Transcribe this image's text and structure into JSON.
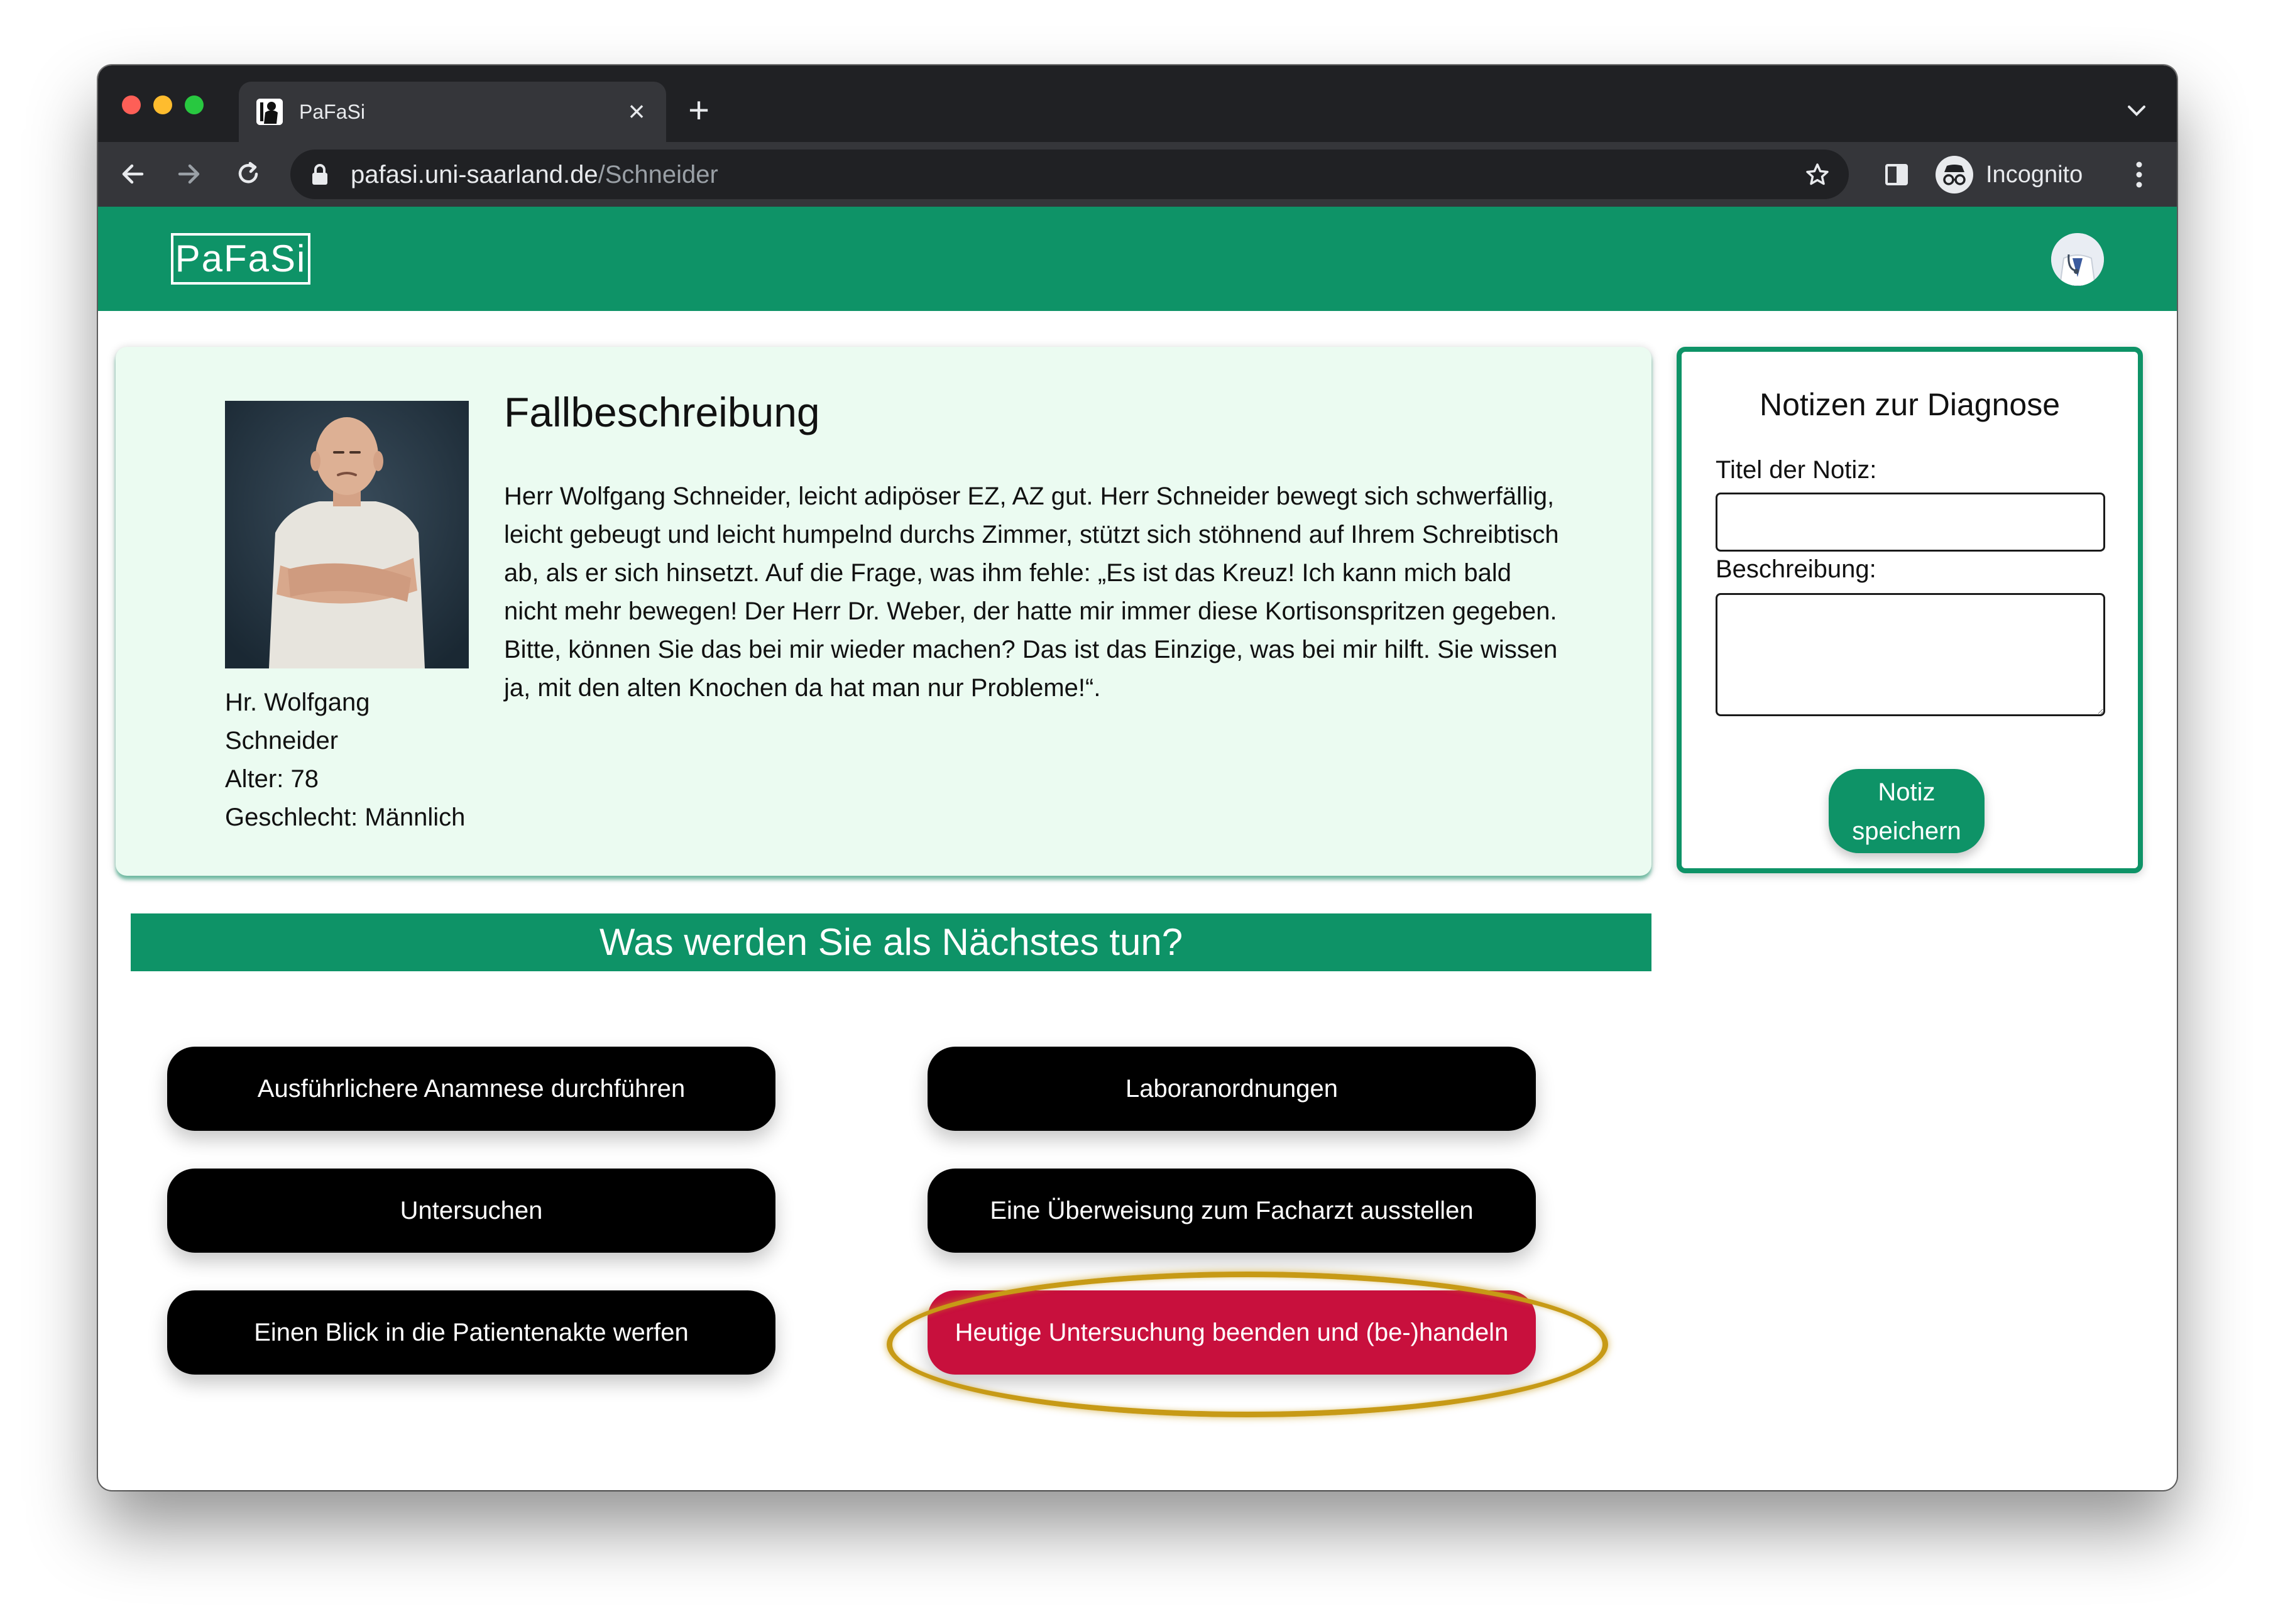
{
  "browser": {
    "tab_title": "PaFaSi",
    "url_host": "pafasi.uni-saarland.de",
    "url_path": "/Schneider",
    "profile_label": "Incognito",
    "icons": [
      "back-arrow-icon",
      "forward-arrow-icon",
      "reload-icon",
      "lock-icon",
      "star-icon",
      "side-panel-icon",
      "incognito-icon",
      "more-vert-icon",
      "close-icon",
      "plus-icon",
      "chevron-down-icon"
    ]
  },
  "app": {
    "logo": "PaFaSi",
    "accent_color": "#0e9367",
    "danger_color": "#c8103d"
  },
  "case": {
    "heading": "Fallbeschreibung",
    "patient_name_line1": "Hr. Wolfgang",
    "patient_name_line2": "Schneider",
    "age": "Alter: 78",
    "gender": "Geschlecht: Männlich",
    "description": "Herr Wolfgang Schneider, leicht adipöser EZ, AZ gut. Herr Schneider bewegt sich schwerfällig, leicht gebeugt und leicht humpelnd durchs Zimmer, stützt sich stöhnend auf Ihrem Schreibtisch ab, als er sich hinsetzt. Auf die Frage, was ihm fehle: „Es ist das Kreuz! Ich kann mich bald nicht mehr bewegen! Der Herr Dr. Weber, der hatte mir immer diese Kortisonspritzen gegeben. Bitte, können Sie das bei mir wieder machen? Das ist das Einzige, was bei mir hilft. Sie wissen ja, mit den alten Knochen da hat man nur Probleme!“."
  },
  "notes": {
    "heading": "Notizen zur Diagnose",
    "title_label": "Titel der Notiz:",
    "title_value": "",
    "description_label": "Beschreibung:",
    "description_value": "",
    "save_line1": "Notiz",
    "save_line2": "speichern"
  },
  "next": {
    "heading": "Was werden Sie als Nächstes tun?",
    "actions": [
      "Ausführlichere Anamnese durchführen",
      "Laboranordnungen",
      "Untersuchen",
      "Eine Überweisung zum Facharzt ausstellen",
      "Einen Blick in die Patientenakte werfen",
      "Heutige Untersuchung beenden und (be-)handeln"
    ]
  }
}
